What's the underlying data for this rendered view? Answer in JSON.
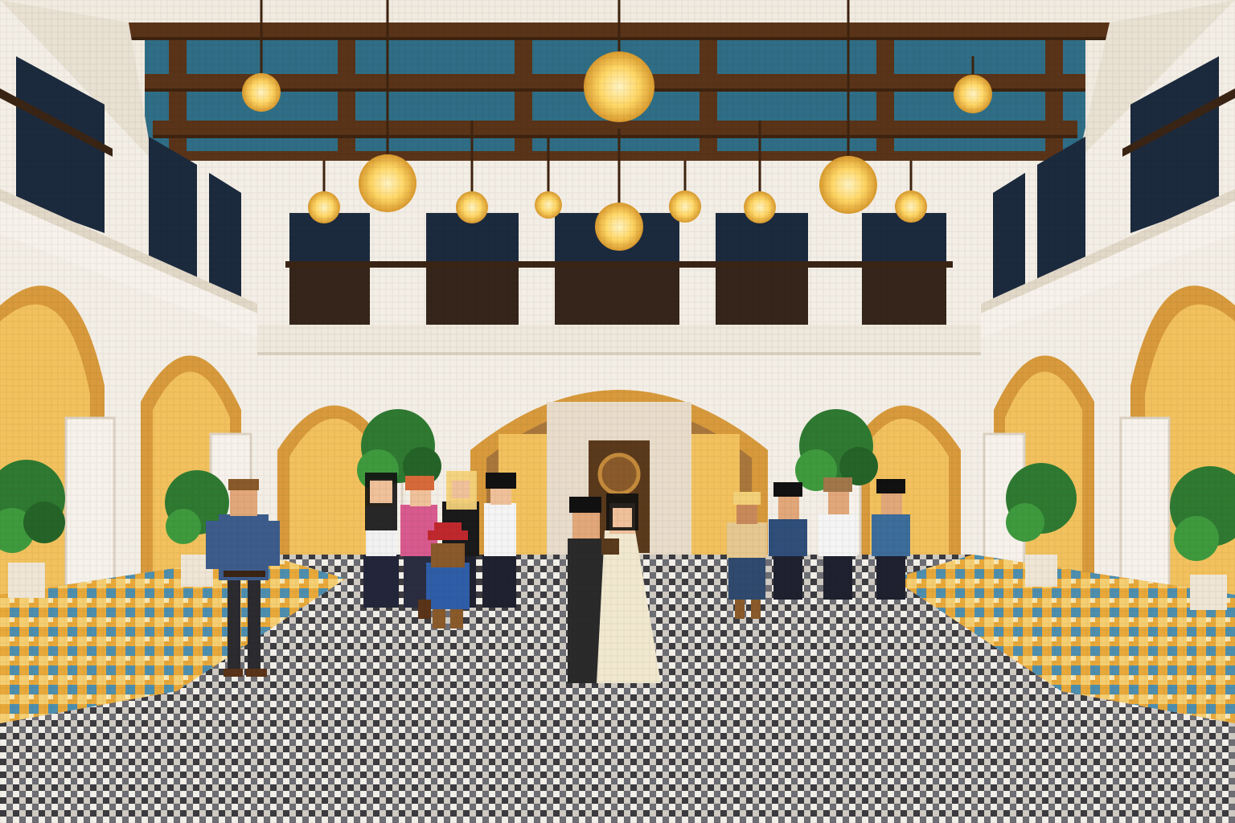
{
  "scene": {
    "setting": "courtyard-ballroom",
    "style": "pixel-art",
    "colors": {
      "ceiling": "#f1ebe0",
      "beam": "#5a3418",
      "beam_dark": "#3e230f",
      "panel": "#2f6e86",
      "wall": "#f4efe6",
      "wall_shadow": "#ddd3c3",
      "arch_trim": "#d89a3c",
      "arch_inner": "#f3c25e",
      "window": "#1c2a3e",
      "railing": "#3a2414",
      "floor_light": "#f2efe9",
      "floor_dark": "#3b3b40",
      "carpet_gold": "#e9a93a",
      "carpet_blue": "#4f8fae",
      "lantern": "#ffd766",
      "plant": "#2f7a32",
      "pot": "#efe6d6"
    },
    "icons": [
      "lantern-icon",
      "plant-icon",
      "door-emblem-icon"
    ]
  }
}
